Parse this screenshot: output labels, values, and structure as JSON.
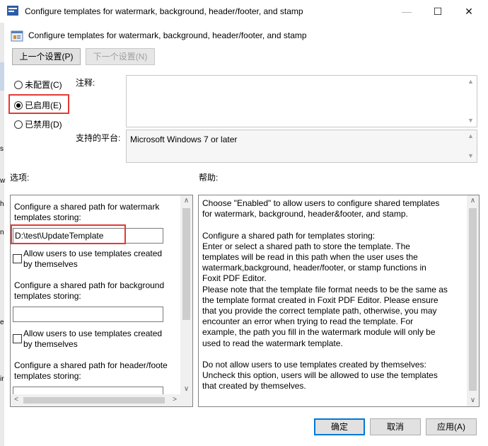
{
  "window": {
    "title": "Configure templates for watermark, background, header/footer, and stamp",
    "minimize": "—",
    "maximize": "☐",
    "close": "✕"
  },
  "header": {
    "policy_title": "Configure templates for watermark, background, header/footer, and stamp",
    "prev_button": "上一个设置(P)",
    "next_button": "下一个设置(N)"
  },
  "state": {
    "options": [
      {
        "label": "未配置(C)",
        "selected": false
      },
      {
        "label": "已启用(E)",
        "selected": true
      },
      {
        "label": "已禁用(D)",
        "selected": false
      }
    ]
  },
  "comment": {
    "label": "注释:",
    "value": ""
  },
  "platform": {
    "label": "支持的平台:",
    "value": "Microsoft Windows 7 or later"
  },
  "options_section": {
    "label": "选项:",
    "watermark_label_1": "Configure a shared path for watermark",
    "watermark_label_2": "templates storing:",
    "watermark_path": "D:\\test\\UpdateTemplate",
    "watermark_checkbox_1": "Allow users to use templates created",
    "watermark_checkbox_2": "by themselves",
    "background_label_1": "Configure a shared path for background",
    "background_label_2": "templates storing:",
    "background_path": "",
    "background_checkbox_1": "Allow users to use templates created",
    "background_checkbox_2": "by themselves",
    "header_label_1": "Configure a shared path for header/foote",
    "header_label_2": "templates storing:"
  },
  "help_section": {
    "label": "帮助:",
    "lines": [
      "Choose \"Enabled\" to allow users to configure shared templates",
      "for watermark, background, header&footer, and stamp.",
      "",
      "Configure a shared path for templates storing:",
      "Enter or select a shared path to store the template. The",
      "templates will be read in this path when the user uses the",
      "watermark,background, header/footer, or stamp functions in",
      "Foxit PDF Editor.",
      "Please note that the template file format needs to be the same as",
      "the template format created in Foxit PDF Editor. Please ensure",
      "that you provide the correct template path, otherwise, you may",
      "encounter an error when trying to read the template. For",
      "example, the path you fill in the watermark module will only be",
      "used to read the watermark template.",
      "",
      "Do not allow users to use templates created by themselves:",
      "Uncheck this option, users will be allowed to use the templates",
      "that created by themselves."
    ]
  },
  "footer": {
    "ok": "确定",
    "cancel": "取消",
    "apply": "应用(A)"
  },
  "background_window": {
    "edge_letters": [
      "s",
      "w",
      "h",
      "n",
      "e",
      "ir"
    ]
  },
  "colors": {
    "highlight_red": "#e53935",
    "focus_blue": "#0078d7",
    "dialog_bg": "#ffffff"
  }
}
